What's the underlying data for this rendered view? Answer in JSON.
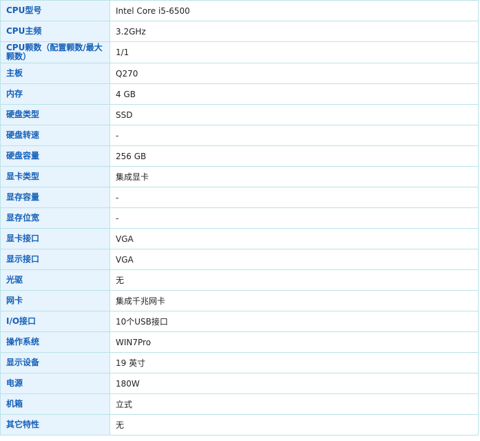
{
  "specs": [
    {
      "label": "CPU型号",
      "value": "Intel Core i5-6500"
    },
    {
      "label": "CPU主频",
      "value": "3.2GHz"
    },
    {
      "label": "CPU颗数（配置颗数/最大颗数）",
      "value": "1/1"
    },
    {
      "label": "主板",
      "value": "Q270"
    },
    {
      "label": "内存",
      "value": "4  GB"
    },
    {
      "label": "硬盘类型",
      "value": "SSD"
    },
    {
      "label": "硬盘转速",
      "value": "-"
    },
    {
      "label": "硬盘容量",
      "value": "256  GB"
    },
    {
      "label": "显卡类型",
      "value": "集成显卡"
    },
    {
      "label": "显存容量",
      "value": "-"
    },
    {
      "label": "显存位宽",
      "value": "-"
    },
    {
      "label": "显卡接口",
      "value": "VGA"
    },
    {
      "label": "显示接口",
      "value": "VGA"
    },
    {
      "label": "光驱",
      "value": "无"
    },
    {
      "label": "网卡",
      "value": "集成千兆网卡"
    },
    {
      "label": "I/O接口",
      "value": "10个USB接口"
    },
    {
      "label": "操作系统",
      "value": "WIN7Pro"
    },
    {
      "label": "显示设备",
      "value": "19  英寸"
    },
    {
      "label": "电源",
      "value": "180W"
    },
    {
      "label": "机箱",
      "value": "立式"
    },
    {
      "label": "其它特性",
      "value": "无"
    }
  ]
}
